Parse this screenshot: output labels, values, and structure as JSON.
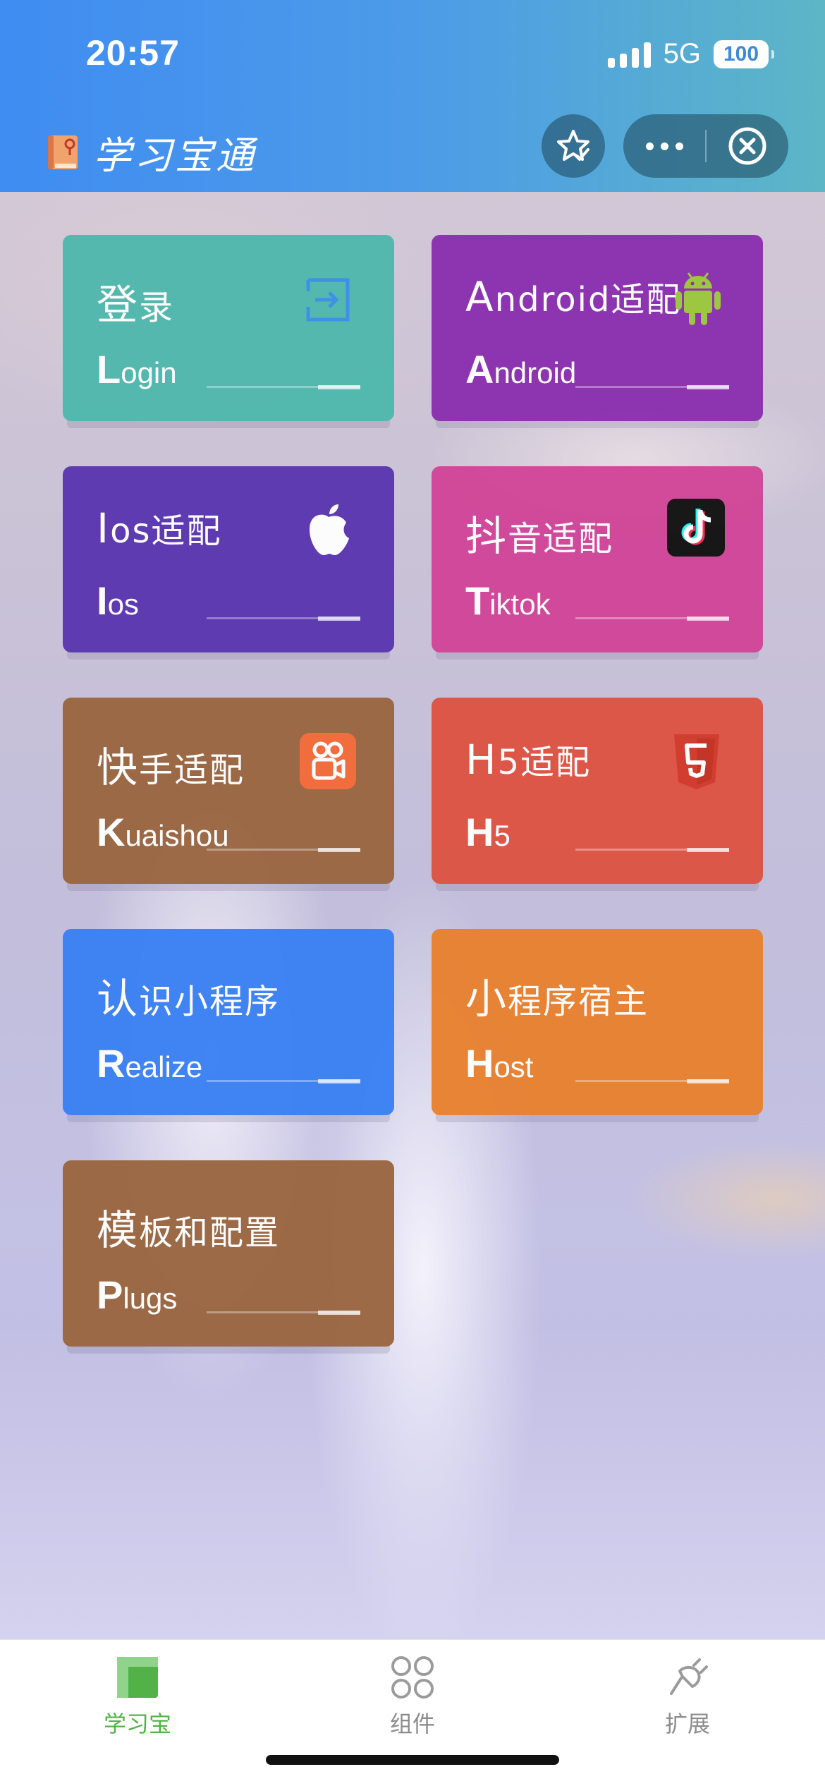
{
  "status_bar": {
    "time": "20:57",
    "network": "5G",
    "battery": "100"
  },
  "header": {
    "title": "学习宝通"
  },
  "cards": [
    {
      "title_first": "登",
      "title_rest": "录",
      "sub_first": "L",
      "sub_rest": "ogin",
      "color": "#4fb8ad",
      "icon": "login-icon"
    },
    {
      "title_first": "A",
      "title_rest": "ndroid适配",
      "sub_first": "A",
      "sub_rest": "ndroid",
      "color": "#8b2fb0",
      "icon": "android-icon"
    },
    {
      "title_first": "I",
      "title_rest": "os适配",
      "sub_first": "I",
      "sub_rest": "os",
      "color": "#5a36b0",
      "icon": "apple-icon"
    },
    {
      "title_first": "抖",
      "title_rest": "音适配",
      "sub_first": "T",
      "sub_rest": "iktok",
      "color": "#d24598",
      "icon": "tiktok-icon"
    },
    {
      "title_first": "快",
      "title_rest": "手适配",
      "sub_first": "K",
      "sub_rest": "uaishou",
      "color": "#9a6640",
      "icon": "kuaishou-icon"
    },
    {
      "title_first": "H",
      "title_rest": "5适配",
      "sub_first": "H",
      "sub_rest": "5",
      "color": "#dd5342",
      "icon": "html5-icon"
    },
    {
      "title_first": "认",
      "title_rest": "识小程序",
      "sub_first": "R",
      "sub_rest": "ealize",
      "color": "#3a80f3",
      "icon": ""
    },
    {
      "title_first": "小",
      "title_rest": "程序宿主",
      "sub_first": "H",
      "sub_rest": "ost",
      "color": "#e8812f",
      "icon": ""
    },
    {
      "title_first": "模",
      "title_rest": "板和配置",
      "sub_first": "P",
      "sub_rest": "lugs",
      "color": "#9a6640",
      "icon": ""
    }
  ],
  "tabbar": {
    "items": [
      {
        "label": "学习宝",
        "icon": "book-layout-icon",
        "active": true
      },
      {
        "label": "组件",
        "icon": "components-icon",
        "active": false
      },
      {
        "label": "扩展",
        "icon": "plug-icon",
        "active": false
      }
    ],
    "active_color": "#52b247",
    "inactive_color": "#8c8c8c"
  }
}
